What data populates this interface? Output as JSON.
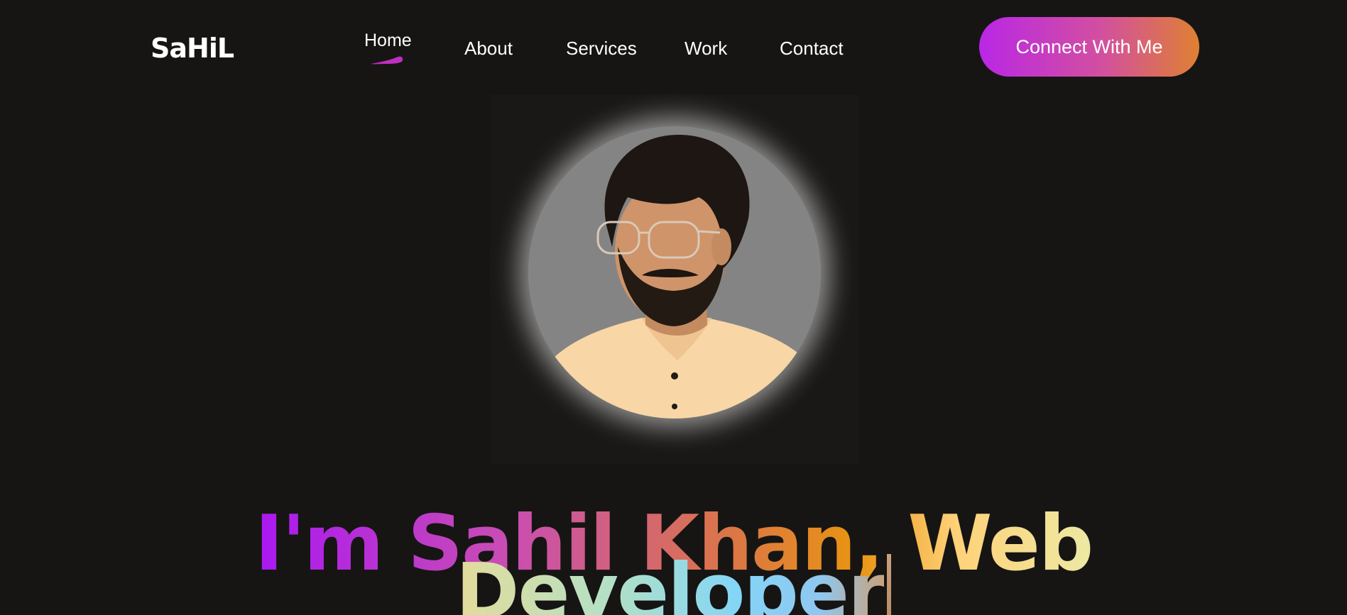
{
  "brand": {
    "logo_text": "SaHiL"
  },
  "nav": {
    "items": [
      {
        "label": "Home",
        "active": true
      },
      {
        "label": "About",
        "active": false
      },
      {
        "label": "Services",
        "active": false
      },
      {
        "label": "Work",
        "active": false
      },
      {
        "label": "Contact",
        "active": false
      }
    ],
    "cta_label": "Connect With Me"
  },
  "hero": {
    "headline_line1": "I'm Sahil Khan, Web",
    "headline_line2": "Developer"
  },
  "colors": {
    "background": "#161514",
    "accent_purple": "#b927e6",
    "accent_orange": "#df8032",
    "text": "#ffffff"
  },
  "icons": {
    "active_indicator": "brush-stroke-underline"
  }
}
